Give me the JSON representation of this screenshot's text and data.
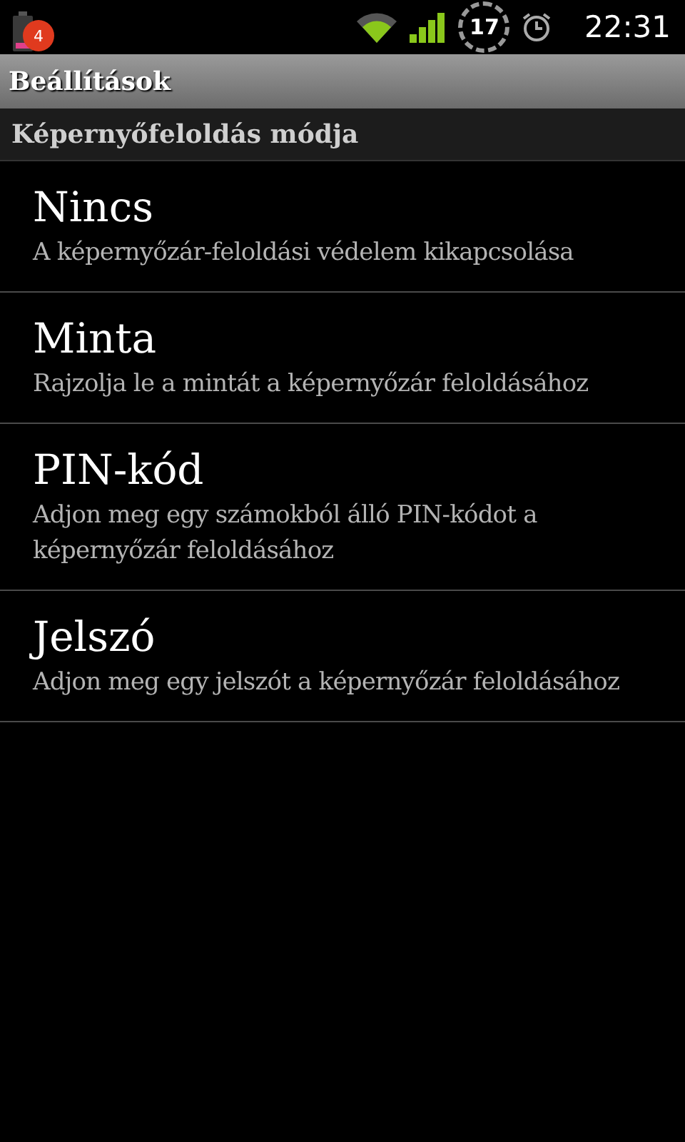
{
  "status_bar": {
    "notification_count": "4",
    "calendar_day": "17",
    "time": "22:31"
  },
  "title_bar": {
    "title": "Beállítások"
  },
  "category": {
    "title": "Képernyőfeloldás módja"
  },
  "options": [
    {
      "title": "Nincs",
      "summary": "A képernyőzár-feloldási védelem kikapcsolása"
    },
    {
      "title": "Minta",
      "summary": "Rajzolja le a mintát a képernyőzár feloldásához"
    },
    {
      "title": "PIN-kód",
      "summary": "Adjon meg egy számokból álló PIN-kódot a képernyőzár feloldásához"
    },
    {
      "title": "Jelszó",
      "summary": "Adjon meg egy jelszót a képernyőzár feloldásához"
    }
  ]
}
